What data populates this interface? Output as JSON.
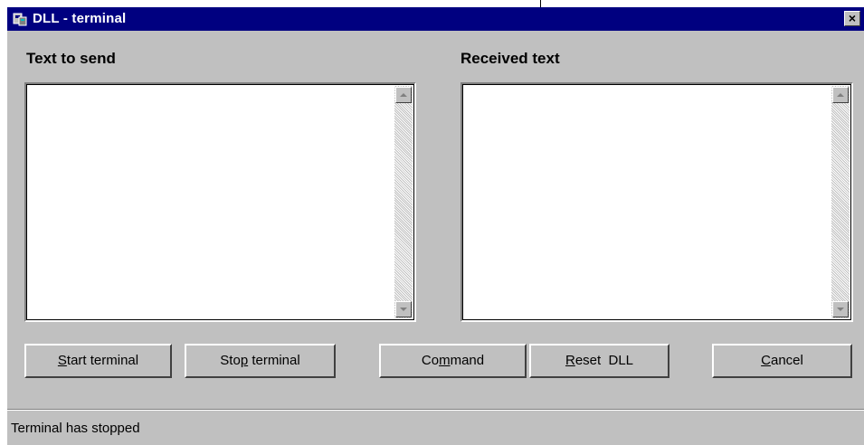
{
  "window": {
    "title": "DLL - terminal",
    "close_label": "×"
  },
  "panels": {
    "send_label": "Text to send",
    "send_value": "",
    "received_label": "Received text",
    "received_value": ""
  },
  "buttons": {
    "start": {
      "pre": "",
      "u": "S",
      "post": "tart terminal"
    },
    "stop": {
      "pre": "Sto",
      "u": "p",
      "post": " terminal"
    },
    "command": {
      "pre": "Co",
      "u": "m",
      "post": "mand"
    },
    "reset": {
      "pre": "",
      "u": "R",
      "post": "eset  DLL"
    },
    "cancel": {
      "pre": "",
      "u": "C",
      "post": "ancel"
    }
  },
  "status": {
    "text": "Terminal has stopped"
  },
  "colors": {
    "titlebar": "#000080",
    "face": "#c0c0c0"
  }
}
